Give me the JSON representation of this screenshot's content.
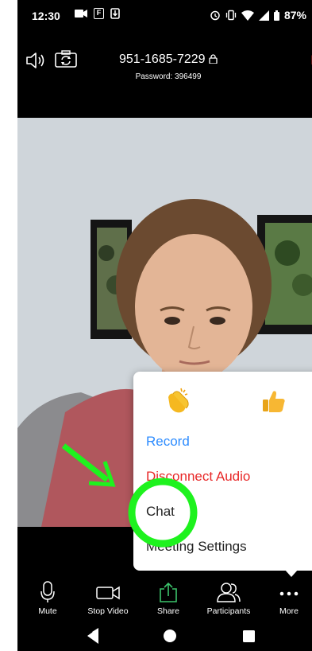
{
  "status_bar": {
    "time": "12:30",
    "f_badge": "F",
    "battery_percent": "87%"
  },
  "meeting": {
    "meeting_id": "951-1685-7229",
    "password_line": "Password: 396499",
    "end_label": "En"
  },
  "menu": {
    "reaction_clap": "clapping-hands-emoji",
    "reaction_thumbs": "thumbs-up-emoji",
    "items": [
      {
        "label": "Record",
        "color": "#2d8cff"
      },
      {
        "label": "Disconnect Audio",
        "color": "#e82828"
      },
      {
        "label": "Chat",
        "color": "#222222"
      },
      {
        "label": "Meeting Settings",
        "color": "#222222"
      }
    ]
  },
  "toolbar": {
    "items": [
      {
        "label": "Mute",
        "icon": "microphone-icon"
      },
      {
        "label": "Stop Video",
        "icon": "video-camera-icon"
      },
      {
        "label": "Share",
        "icon": "share-icon",
        "color": "#3cc46b"
      },
      {
        "label": "Participants",
        "icon": "participants-icon"
      },
      {
        "label": "More",
        "icon": "more-dots-icon"
      }
    ]
  },
  "annotation": {
    "circle_color": "#1ef21e",
    "arrow_color": "#1ef21e",
    "highlighted_item": "Chat"
  },
  "colors": {
    "accent_blue": "#2d8cff",
    "danger_red": "#e82828",
    "share_green": "#3cc46b"
  }
}
